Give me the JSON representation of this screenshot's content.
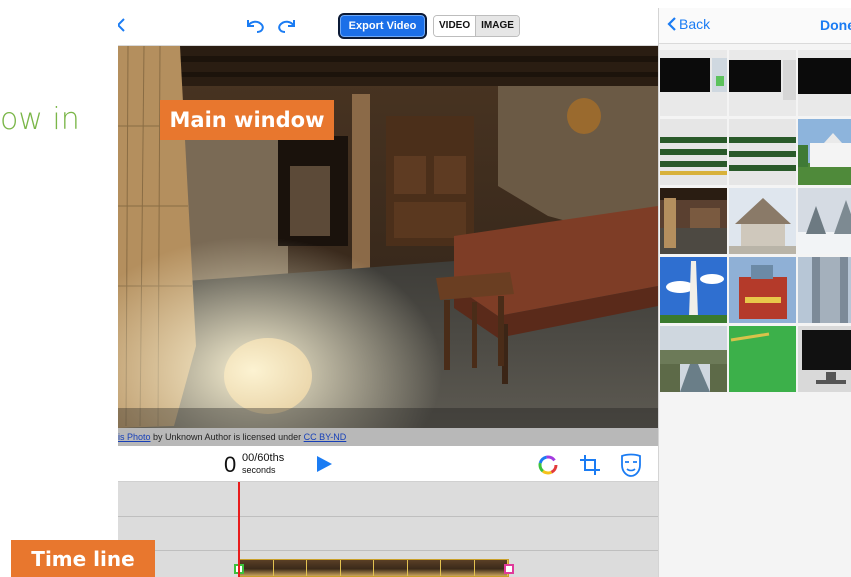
{
  "slide": {
    "partial_text": "ow in"
  },
  "toolbar": {
    "undo_icon": "undo-icon",
    "redo_icon": "redo-icon",
    "export_label": "Export Video",
    "mode_video": "VIDEO",
    "mode_image": "IMAGE",
    "accent": "#1b6fe8"
  },
  "main_window": {
    "label": "Main window",
    "attribution_link": "is Photo",
    "attribution_text": " by Unknown Author is licensed under ",
    "license_link": "CC BY-ND"
  },
  "playback": {
    "time_big": "0",
    "time_fraction": "00/60ths",
    "time_unit": "seconds",
    "play_icon": "play-icon",
    "color_icon": "color-wheel-icon",
    "crop_icon": "crop-icon",
    "mask_icon": "mask-icon"
  },
  "timeline": {
    "label": "Time line",
    "clip_frames": 8,
    "playhead_color": "#e81c1c"
  },
  "library": {
    "back_label": "Back",
    "done_label": "Done",
    "link_color": "#1b7cf3",
    "thumbnails": [
      {
        "subject": "video-screenshot-1"
      },
      {
        "subject": "video-screenshot-2"
      },
      {
        "subject": "video-screenshot-3"
      },
      {
        "subject": "timeline-screenshot-1"
      },
      {
        "subject": "timeline-screenshot-2"
      },
      {
        "subject": "white-house"
      },
      {
        "subject": "interior-room"
      },
      {
        "subject": "cottage"
      },
      {
        "subject": "snowy-trees"
      },
      {
        "subject": "washington-monument"
      },
      {
        "subject": "red-building"
      },
      {
        "subject": "skyscraper"
      },
      {
        "subject": "canal"
      },
      {
        "subject": "green-screen"
      },
      {
        "subject": "monitor"
      }
    ]
  }
}
